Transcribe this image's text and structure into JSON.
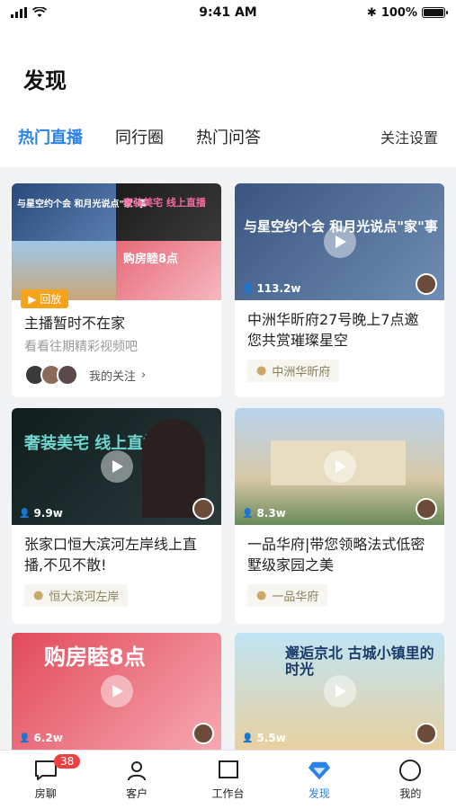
{
  "status_bar": {
    "time": "9:41 AM",
    "battery": "100%"
  },
  "page": {
    "title": "发现"
  },
  "tabs": {
    "items": [
      "热门直播",
      "同行圈",
      "热门问答"
    ],
    "settings": "关注设置"
  },
  "cards": [
    {
      "thumb_title": "与星空约个会 和月光说点\"家\"事",
      "thumb_title2": "奢装美宅 线上直播",
      "thumb_title3": "购房睦8点",
      "badge": "回放",
      "title": "主播暂时不在家",
      "subtitle": "看看往期精彩视频吧",
      "follow_label": "我的关注"
    },
    {
      "thumb_title": "与星空约个会 和月光说点\"家\"事",
      "views": "113.2w",
      "title": "中洲华昕府27号晚上7点邀您共赏璀璨星空",
      "location": "中洲华昕府"
    },
    {
      "thumb_title": "奢装美宅 线上直播",
      "views": "9.9w",
      "title": "张家口恒大滨河左岸线上直播,不见不散!",
      "location": "恒大滨河左岸"
    },
    {
      "views": "8.3w",
      "title": "一品华府|带您领略法式低密墅级家园之美",
      "location": "一品华府"
    },
    {
      "thumb_title": "购房睦8点",
      "views": "6.2w"
    },
    {
      "thumb_title": "邂逅京北 古城小镇里的时光",
      "views": "5.5w"
    }
  ],
  "tabbar": {
    "items": [
      {
        "label": "房聊",
        "icon": "chat-icon",
        "badge": "38"
      },
      {
        "label": "客户",
        "icon": "user-icon"
      },
      {
        "label": "工作台",
        "icon": "workbench-icon"
      },
      {
        "label": "发现",
        "icon": "diamond-icon",
        "active": true
      },
      {
        "label": "我的",
        "icon": "circle-icon"
      }
    ]
  },
  "colors": {
    "accent": "#2b82e8",
    "badge": "#ef4040",
    "replay": "#f7a21b"
  }
}
